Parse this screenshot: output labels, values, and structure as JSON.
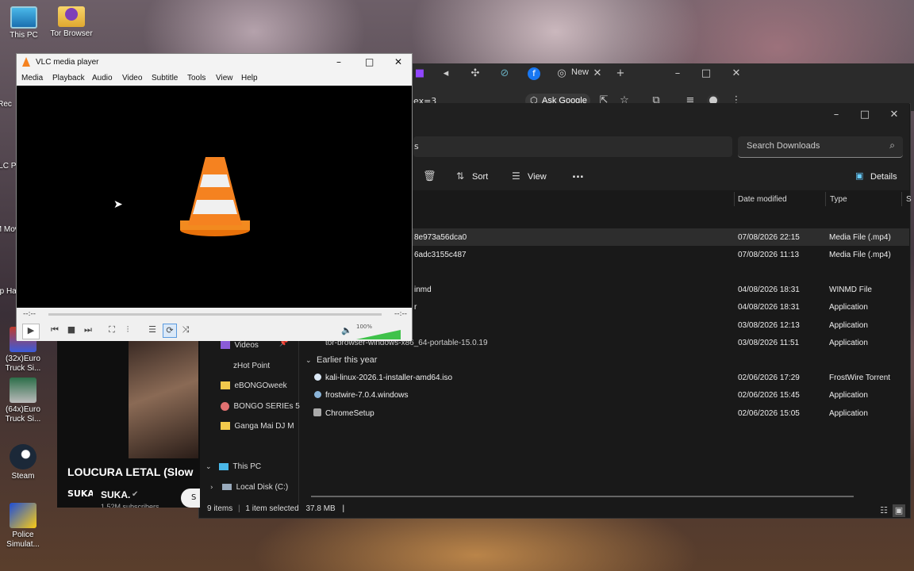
{
  "desktop": {
    "icons": [
      {
        "label": "This PC"
      },
      {
        "label": "Tor Browser"
      },
      {
        "label": "(32x)Euro Truck Si..."
      },
      {
        "label": "(64x)Euro Truck Si..."
      },
      {
        "label": "Steam"
      },
      {
        "label": "Police Simulat..."
      }
    ],
    "partial_labels": [
      "Rec",
      "VLC P",
      "_M Mov",
      "Opp Ha i"
    ]
  },
  "browser": {
    "tab_label": "New",
    "url_fragment": "ex=3",
    "ask_google": "Ask Google"
  },
  "explorer": {
    "search_placeholder": "Search Downloads",
    "path_fragment": "s",
    "toolbar": {
      "sort": "Sort",
      "view": "View",
      "more": "...",
      "details": "Details"
    },
    "columns": {
      "date": "Date modified",
      "type": "Type",
      "size": "S"
    },
    "rows": [
      {
        "name": "8e973a56dca0",
        "date": "07/08/2026 22:15",
        "type": "Media File (.mp4)"
      },
      {
        "name": "6adc3155c487",
        "date": "07/08/2026 11:13",
        "type": "Media File (.mp4)"
      },
      {
        "name": "inmd",
        "date": "04/08/2026 18:31",
        "type": "WINMD File"
      },
      {
        "name": "r",
        "date": "04/08/2026 18:31",
        "type": "Application"
      },
      {
        "name": "",
        "date": "03/08/2026 12:13",
        "type": "Application"
      },
      {
        "name": "tor-browser-windows-x86_64-portable-15.0.19",
        "date": "03/08/2026 11:51",
        "type": "Application"
      }
    ],
    "group_label": "Earlier this year",
    "group_rows": [
      {
        "name": "kali-linux-2026.1-installer-amd64.iso",
        "date": "02/06/2026 17:29",
        "type": "FrostWire Torrent"
      },
      {
        "name": "frostwire-7.0.4.windows",
        "date": "02/06/2026 15:45",
        "type": "Application"
      },
      {
        "name": "ChromeSetup",
        "date": "02/06/2026 15:05",
        "type": "Application"
      }
    ],
    "nav": [
      {
        "label": "Videos"
      },
      {
        "label": "zHot Point"
      },
      {
        "label": "eBONGOweek"
      },
      {
        "label": "BONGO SERIEs 5"
      },
      {
        "label": "Ganga Mai DJ M"
      },
      {
        "label": "This PC"
      },
      {
        "label": "Local Disk (C:)"
      }
    ],
    "status": {
      "items": "9 items",
      "selected": "1 item selected",
      "size": "37.8 MB"
    }
  },
  "vlc": {
    "title": "VLC media player",
    "menu": [
      "Media",
      "Playback",
      "Audio",
      "Video",
      "Subtitle",
      "Tools",
      "View",
      "Help"
    ],
    "time_left": "--:--",
    "time_right": "--:--",
    "volume": "100%",
    "volume_level": 1.0
  },
  "youtube": {
    "video_title": "LOUCURA LETAL (Slow",
    "channel": "SUKA.",
    "channel_badge": "SUKA",
    "subscribers": "1.52M subscribers",
    "subscribe": "S"
  }
}
